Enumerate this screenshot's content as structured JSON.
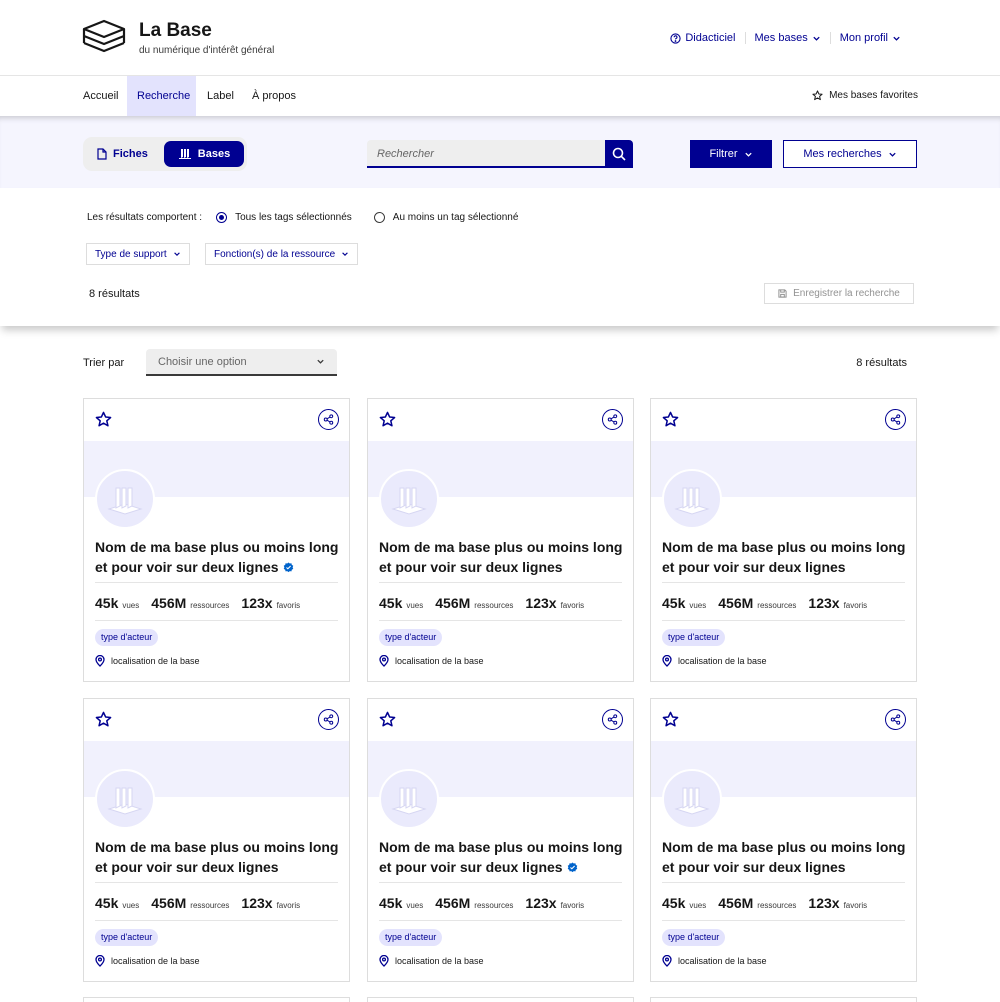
{
  "header": {
    "brand_title": "La Base",
    "brand_subtitle": "du numérique d'intérêt général",
    "links": [
      {
        "label": "Didacticiel",
        "icon": "help-circle-icon"
      },
      {
        "label": "Mes bases",
        "icon": "chevron-down-icon"
      },
      {
        "label": "Mon profil",
        "icon": "chevron-down-icon"
      }
    ]
  },
  "nav": {
    "items": [
      {
        "label": "Accueil",
        "active": false
      },
      {
        "label": "Recherche",
        "active": true
      },
      {
        "label": "Label",
        "active": false
      },
      {
        "label": "À propos",
        "active": false
      }
    ],
    "favorites_label": "Mes bases favorites"
  },
  "search_bar": {
    "toggle": {
      "fiches_label": "Fiches",
      "bases_label": "Bases",
      "selected": "Bases"
    },
    "placeholder": "Rechercher",
    "filter_button": "Filtrer",
    "saved_searches_button": "Mes recherches"
  },
  "filters": {
    "results_include_label": "Les résultats comportent :",
    "options": [
      {
        "label": "Tous les tags sélectionnés",
        "selected": true
      },
      {
        "label": "Au moins un tag sélectionné",
        "selected": false
      }
    ],
    "dropdowns": [
      "Type de support",
      "Fonction(s) de la ressource"
    ],
    "results_count": "8 résultats",
    "save_search_button": "Enregistrer la recherche"
  },
  "sort": {
    "label": "Trier par",
    "placeholder": "Choisir une option",
    "results_count": "8 résultats"
  },
  "cards": [
    {
      "title": "Nom de ma base plus ou moins long et pour voir sur deux lignes",
      "verified": true,
      "views": "45k",
      "views_unit": "vues",
      "resources": "456M",
      "resources_unit": "ressources",
      "favorites": "123x",
      "favorites_unit": "favoris",
      "tag": "type d'acteur",
      "location": "localisation de la base"
    },
    {
      "title": "Nom de ma base plus ou moins long et pour voir sur deux lignes",
      "verified": false,
      "views": "45k",
      "views_unit": "vues",
      "resources": "456M",
      "resources_unit": "ressources",
      "favorites": "123x",
      "favorites_unit": "favoris",
      "tag": "type d'acteur",
      "location": "localisation de la base"
    },
    {
      "title": "Nom de ma base plus ou moins long et pour voir sur deux lignes",
      "verified": false,
      "views": "45k",
      "views_unit": "vues",
      "resources": "456M",
      "resources_unit": "ressources",
      "favorites": "123x",
      "favorites_unit": "favoris",
      "tag": "type d'acteur",
      "location": "localisation de la base"
    },
    {
      "title": "Nom de ma base plus ou moins long et pour voir sur deux lignes",
      "verified": false,
      "views": "45k",
      "views_unit": "vues",
      "resources": "456M",
      "resources_unit": "ressources",
      "favorites": "123x",
      "favorites_unit": "favoris",
      "tag": "type d'acteur",
      "location": "localisation de la base"
    },
    {
      "title": "Nom de ma base plus ou moins long et pour voir sur deux lignes",
      "verified": true,
      "views": "45k",
      "views_unit": "vues",
      "resources": "456M",
      "resources_unit": "ressources",
      "favorites": "123x",
      "favorites_unit": "favoris",
      "tag": "type d'acteur",
      "location": "localisation de la base"
    },
    {
      "title": "Nom de ma base plus ou moins long et pour voir sur deux lignes",
      "verified": false,
      "views": "45k",
      "views_unit": "vues",
      "resources": "456M",
      "resources_unit": "ressources",
      "favorites": "123x",
      "favorites_unit": "favoris",
      "tag": "type d'acteur",
      "location": "localisation de la base"
    }
  ],
  "colors": {
    "primary": "#000091",
    "accent_light": "#e3e3fd",
    "band": "#f5f5fe",
    "verified": "#0063cb"
  }
}
